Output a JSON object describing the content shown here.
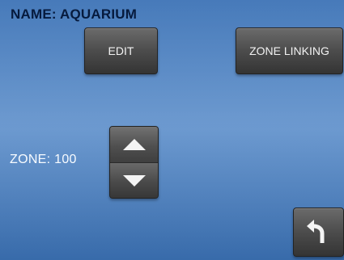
{
  "header": {
    "title": "NAME: AQUARIUM"
  },
  "buttons": {
    "edit": "EDIT",
    "zone_linking": "ZONE LINKING"
  },
  "zone": {
    "label": "ZONE: 100"
  },
  "icons": {
    "up": "up-arrow-icon",
    "down": "down-arrow-icon",
    "back": "back-arrow-icon"
  },
  "colors": {
    "background": "#4b82c3",
    "button": "#4d4d4d",
    "title_text": "#061a3d",
    "label_text": "#f7fbff"
  }
}
